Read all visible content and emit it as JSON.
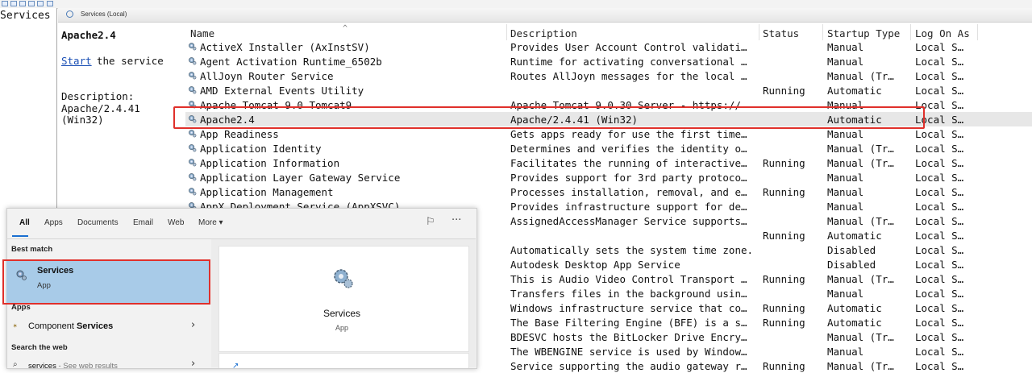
{
  "tree": {
    "item_label": "Services ("
  },
  "header": {
    "title": "Services (Local)"
  },
  "detail": {
    "service_title": "Apache2.4",
    "start_link": "Start",
    "start_rest": " the service",
    "description_label": "Description:",
    "description_value": "Apache/2.4.41 (Win32)"
  },
  "columns": {
    "name": "Name",
    "description": "Description",
    "status": "Status",
    "startup_type": "Startup Type",
    "log_on_as": "Log On As"
  },
  "rows": [
    {
      "name": "ActiveX Installer (AxInstSV)",
      "desc": "Provides User Account Control validati…",
      "status": "",
      "startup": "Manual",
      "logon": "Local S…"
    },
    {
      "name": "Agent Activation Runtime_6502b",
      "desc": "Runtime for activating conversational …",
      "status": "",
      "startup": "Manual",
      "logon": "Local S…"
    },
    {
      "name": "AllJoyn Router Service",
      "desc": "Routes AllJoyn messages for the local …",
      "status": "",
      "startup": "Manual (Tr…",
      "logon": "Local S…"
    },
    {
      "name": "AMD External Events Utility",
      "desc": "",
      "status": "Running",
      "startup": "Automatic",
      "logon": "Local S…"
    },
    {
      "name": "Apache Tomcat 9.0 Tomcat9",
      "desc": "Apache Tomcat 9.0.30 Server - https://",
      "status": "",
      "startup": "Manual",
      "logon": "Local S…"
    },
    {
      "name": "Apache2.4",
      "desc": "Apache/2.4.41 (Win32)",
      "status": "",
      "startup": "Automatic",
      "logon": "Local S…"
    },
    {
      "name": "App Readiness",
      "desc": "Gets apps ready for use the first time…",
      "status": "",
      "startup": "Manual",
      "logon": "Local S…"
    },
    {
      "name": "Application Identity",
      "desc": "Determines and verifies the identity o…",
      "status": "",
      "startup": "Manual (Tr…",
      "logon": "Local S…"
    },
    {
      "name": "Application Information",
      "desc": "Facilitates the running of interactive…",
      "status": "Running",
      "startup": "Manual (Tr…",
      "logon": "Local S…"
    },
    {
      "name": "Application Layer Gateway Service",
      "desc": "Provides support for 3rd party protoco…",
      "status": "",
      "startup": "Manual",
      "logon": "Local S…"
    },
    {
      "name": "Application Management",
      "desc": "Processes installation, removal, and e…",
      "status": "Running",
      "startup": "Manual",
      "logon": "Local S…"
    },
    {
      "name": "AppX Deployment Service (AppXSVC)",
      "desc": "Provides infrastructure support for de…",
      "status": "",
      "startup": "Manual",
      "logon": "Local S…"
    },
    {
      "name": "",
      "desc": "AssignedAccessManager Service supports…",
      "status": "",
      "startup": "Manual (Tr…",
      "logon": "Local S…"
    },
    {
      "name": "",
      "desc": "",
      "status": "Running",
      "startup": "Automatic",
      "logon": "Local S…"
    },
    {
      "name": "",
      "desc": "Automatically sets the system time zone.",
      "status": "",
      "startup": "Disabled",
      "logon": "Local S…"
    },
    {
      "name": "",
      "desc": "Autodesk Desktop App Service",
      "status": "",
      "startup": "Disabled",
      "logon": "Local S…"
    },
    {
      "name": "",
      "desc": "This is Audio Video Control Transport …",
      "status": "Running",
      "startup": "Manual (Tr…",
      "logon": "Local S…"
    },
    {
      "name": "",
      "desc": "Transfers files in the background usin…",
      "status": "",
      "startup": "Manual",
      "logon": "Local S…"
    },
    {
      "name": "",
      "desc": "Windows infrastructure service that co…",
      "status": "Running",
      "startup": "Automatic",
      "logon": "Local S…"
    },
    {
      "name": "",
      "desc": "The Base Filtering Engine (BFE) is a s…",
      "status": "Running",
      "startup": "Automatic",
      "logon": "Local S…"
    },
    {
      "name": "",
      "desc": "BDESVC hosts the BitLocker Drive Encry…",
      "status": "",
      "startup": "Manual (Tr…",
      "logon": "Local S…"
    },
    {
      "name": "",
      "desc": "The WBENGINE service is used by Window…",
      "status": "",
      "startup": "Manual",
      "logon": "Local S…"
    },
    {
      "name": "",
      "desc": "Service supporting the audio gateway r…",
      "status": "Running",
      "startup": "Manual (Tr…",
      "logon": "Local S…"
    }
  ],
  "start_menu": {
    "tabs": [
      "All",
      "Apps",
      "Documents",
      "Email",
      "Web",
      "More ▾"
    ],
    "best_match_header": "Best match",
    "best_match_title": "Services",
    "best_match_sub": "App",
    "apps_header": "Apps",
    "apps_item_prefix": "Component ",
    "apps_item_bold": "Services",
    "web_header": "Search the web",
    "web_query": "services",
    "web_hint": "- See web results",
    "preview_title": "Services",
    "preview_sub": "App"
  }
}
